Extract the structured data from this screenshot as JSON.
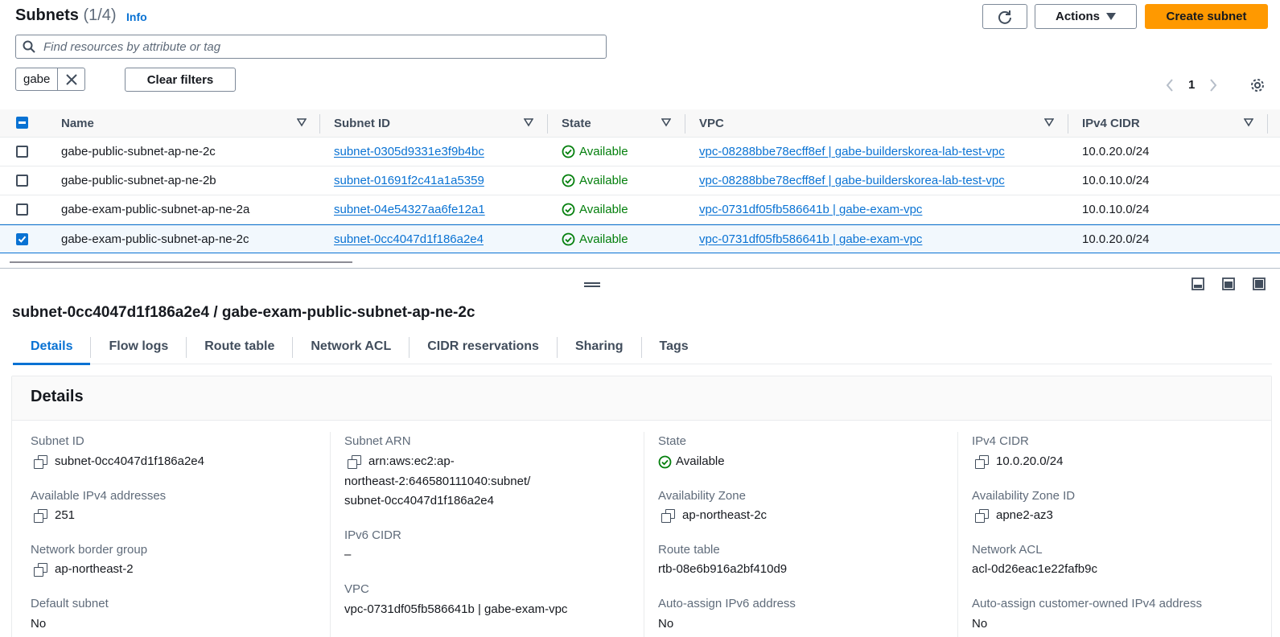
{
  "header": {
    "title": "Subnets",
    "count": "(1/4)",
    "info": "Info",
    "actions_label": "Actions",
    "create_label": "Create subnet"
  },
  "search": {
    "placeholder": "Find resources by attribute or tag"
  },
  "filter": {
    "token": "gabe",
    "clear_label": "Clear filters"
  },
  "pager": {
    "page": "1"
  },
  "table": {
    "columns": [
      "Name",
      "Subnet ID",
      "State",
      "VPC",
      "IPv4 CIDR"
    ],
    "rows": [
      {
        "name": "gabe-public-subnet-ap-ne-2c",
        "subnet_id": "subnet-0305d9331e3f9b4bc",
        "state": "Available",
        "vpc": "vpc-08288bbe78ecff8ef | gabe-builderskorea-lab-test-vpc",
        "cidr": "10.0.20.0/24",
        "selected": false
      },
      {
        "name": "gabe-public-subnet-ap-ne-2b",
        "subnet_id": "subnet-01691f2c41a1a5359",
        "state": "Available",
        "vpc": "vpc-08288bbe78ecff8ef | gabe-builderskorea-lab-test-vpc",
        "cidr": "10.0.10.0/24",
        "selected": false
      },
      {
        "name": "gabe-exam-public-subnet-ap-ne-2a",
        "subnet_id": "subnet-04e54327aa6fe12a1",
        "state": "Available",
        "vpc": "vpc-0731df05fb586641b | gabe-exam-vpc",
        "cidr": "10.0.10.0/24",
        "selected": false
      },
      {
        "name": "gabe-exam-public-subnet-ap-ne-2c",
        "subnet_id": "subnet-0cc4047d1f186a2e4",
        "state": "Available",
        "vpc": "vpc-0731df05fb586641b | gabe-exam-vpc",
        "cidr": "10.0.20.0/24",
        "selected": true
      }
    ]
  },
  "detail": {
    "title": "subnet-0cc4047d1f186a2e4 / gabe-exam-public-subnet-ap-ne-2c",
    "tabs": [
      "Details",
      "Flow logs",
      "Route table",
      "Network ACL",
      "CIDR reservations",
      "Sharing",
      "Tags"
    ],
    "section_title": "Details",
    "fields": {
      "subnet_id": {
        "label": "Subnet ID",
        "value": "subnet-0cc4047d1f186a2e4"
      },
      "available_ipv4": {
        "label": "Available IPv4 addresses",
        "value": "251"
      },
      "network_border_group": {
        "label": "Network border group",
        "value": "ap-northeast-2"
      },
      "default_subnet": {
        "label": "Default subnet",
        "value": "No"
      },
      "subnet_arn": {
        "label": "Subnet ARN",
        "line1": "arn:aws:ec2:ap-",
        "line2": "northeast-2:646580111040:subnet/",
        "line3": "subnet-0cc4047d1f186a2e4"
      },
      "ipv6_cidr": {
        "label": "IPv6 CIDR",
        "value": "–"
      },
      "vpc": {
        "label": "VPC",
        "value": "vpc-0731df05fb586641b | gabe-exam-vpc"
      },
      "state": {
        "label": "State",
        "value": "Available"
      },
      "az": {
        "label": "Availability Zone",
        "value": "ap-northeast-2c"
      },
      "route_table": {
        "label": "Route table",
        "value": "rtb-08e6b916a2bf410d9"
      },
      "auto_ipv6": {
        "label": "Auto-assign IPv6 address",
        "value": "No"
      },
      "ipv4_cidr": {
        "label": "IPv4 CIDR",
        "value": "10.0.20.0/24"
      },
      "az_id": {
        "label": "Availability Zone ID",
        "value": "apne2-az3"
      },
      "network_acl": {
        "label": "Network ACL",
        "value": "acl-0d26eac1e22fafb9c"
      },
      "auto_customer_ipv4": {
        "label": "Auto-assign customer-owned IPv4 address",
        "value": "No"
      }
    }
  },
  "colors": {
    "accent": "#0972d3",
    "primary_button": "#ff9900",
    "success": "#037f0c"
  }
}
